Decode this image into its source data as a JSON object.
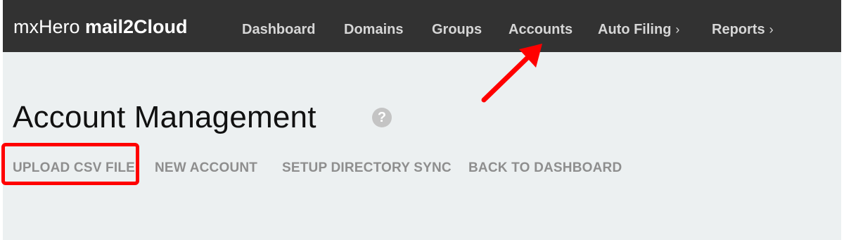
{
  "app": {
    "brand_light": "mxHero ",
    "brand_bold": "mail2Cloud"
  },
  "nav": {
    "items": [
      {
        "label": "Dashboard",
        "has_submenu": false
      },
      {
        "label": "Domains",
        "has_submenu": false
      },
      {
        "label": "Groups",
        "has_submenu": false
      },
      {
        "label": "Accounts",
        "has_submenu": false
      },
      {
        "label": "Auto Filing",
        "has_submenu": true
      },
      {
        "label": "Reports",
        "has_submenu": true
      }
    ],
    "submenu_glyph": "›"
  },
  "page": {
    "title": "Account Management",
    "help_glyph": "?"
  },
  "actions": {
    "upload_csv": "UPLOAD CSV FILE",
    "new_account": "NEW ACCOUNT",
    "setup_sync": "SETUP DIRECTORY SYNC",
    "back_dashboard": "BACK TO DASHBOARD"
  },
  "colors": {
    "topbar": "#323232",
    "nav_text": "#d6d6d6",
    "page_bg": "#ecf0f1",
    "action_text": "#8e8e8e",
    "annotation": "#ff0000"
  },
  "icons": {
    "help": "help-circle-icon",
    "chevron": "chevron-right-icon",
    "annotation_arrow": "red-arrow-icon"
  }
}
